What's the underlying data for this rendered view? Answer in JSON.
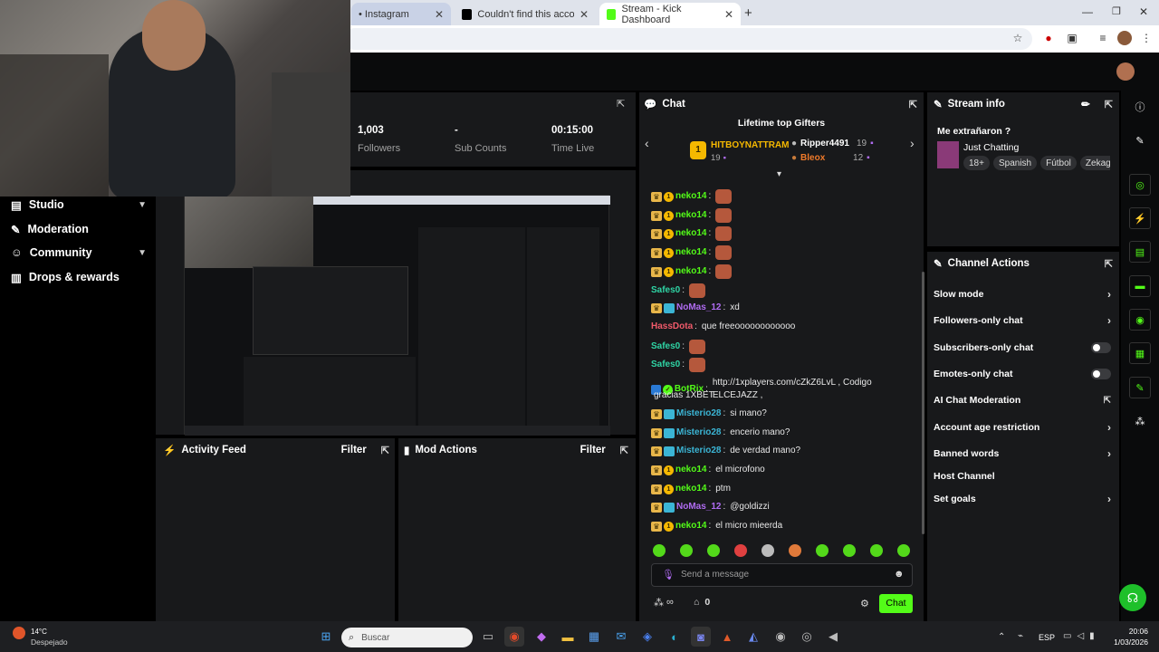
{
  "browser": {
    "tabs": [
      {
        "label": "• Instagram"
      },
      {
        "label": "Couldn't find this account. Visit"
      },
      {
        "label": "Stream - Kick Dashboard"
      }
    ]
  },
  "sidebar": {
    "items": [
      {
        "label": "Studio",
        "icon": "studio-icon",
        "has_chevron": true
      },
      {
        "label": "Moderation",
        "icon": "wrench-icon",
        "has_chevron": false
      },
      {
        "label": "Community",
        "icon": "people-icon",
        "has_chevron": true
      },
      {
        "label": "Drops & rewards",
        "icon": "gift-icon",
        "has_chevron": false
      }
    ]
  },
  "stats": [
    {
      "value": "1,003",
      "label": "Followers"
    },
    {
      "value": "-",
      "label": "Sub Counts"
    },
    {
      "value": "00:15:00",
      "label": "Time Live"
    }
  ],
  "activity_feed": {
    "title": "Activity Feed",
    "filter": "Filter"
  },
  "mod_actions": {
    "title": "Mod Actions",
    "filter": "Filter"
  },
  "chat": {
    "title": "Chat",
    "gifters": {
      "title": "Lifetime top Gifters",
      "first": {
        "rank": "1",
        "name": "HITBOYNATTRAM",
        "count": "19"
      },
      "second": {
        "name": "Ripper4491",
        "count": "19"
      },
      "third": {
        "name": "Bleox",
        "count": "12"
      }
    },
    "messages": [
      {
        "user": "neko14",
        "text": "",
        "color": "#53fc18",
        "badge": "crown-coin",
        "emote": true
      },
      {
        "user": "neko14",
        "text": "",
        "color": "#53fc18",
        "badge": "crown-coin",
        "emote": true
      },
      {
        "user": "neko14",
        "text": "",
        "color": "#53fc18",
        "badge": "crown-coin",
        "emote": true
      },
      {
        "user": "neko14",
        "text": "",
        "color": "#53fc18",
        "badge": "crown-coin",
        "emote": true
      },
      {
        "user": "neko14",
        "text": "",
        "color": "#53fc18",
        "badge": "crown-coin",
        "emote": true
      },
      {
        "user": "Safes0",
        "text": "",
        "color": "#2fd5a5",
        "badge": "none",
        "emote": true
      },
      {
        "user": "NoMas_12",
        "text": "xd",
        "color": "#b06cf2",
        "badge": "crown-box",
        "emote": false
      },
      {
        "user": "HassDota",
        "text": "que freeoooooooooooo",
        "color": "#f05a6a",
        "badge": "none",
        "emote": false
      },
      {
        "user": "Safes0",
        "text": "",
        "color": "#2fd5a5",
        "badge": "none",
        "emote": true
      },
      {
        "user": "Safes0",
        "text": "",
        "color": "#2fd5a5",
        "badge": "none",
        "emote": true
      },
      {
        "user": "BotRix",
        "text": "http://1xplayers.com/cZkZ6LvL , Codigo ELCEJAZZ ,",
        "color": "#53fc18",
        "badge": "bot",
        "emote": false
      },
      {
        "user": "",
        "text": "gracias 1XBET",
        "color": "#e8e8e8",
        "badge": "none",
        "emote": false
      },
      {
        "user": "Misterio28",
        "text": "si mano?",
        "color": "#3bb5d5",
        "badge": "crown-box",
        "emote": false
      },
      {
        "user": "Misterio28",
        "text": "encerio mano?",
        "color": "#3bb5d5",
        "badge": "crown-box",
        "emote": false
      },
      {
        "user": "Misterio28",
        "text": "de verdad mano?",
        "color": "#3bb5d5",
        "badge": "crown-box",
        "emote": false
      },
      {
        "user": "neko14",
        "text": "el microfono",
        "color": "#53fc18",
        "badge": "crown-coin",
        "emote": false
      },
      {
        "user": "neko14",
        "text": "ptm",
        "color": "#53fc18",
        "badge": "crown-coin",
        "emote": false
      },
      {
        "user": "NoMas_12",
        "text": "@goldizzi",
        "color": "#b06cf2",
        "badge": "crown-box",
        "emote": false
      },
      {
        "user": "neko14",
        "text": "el micro mieerda",
        "color": "#53fc18",
        "badge": "crown-coin",
        "emote": false
      }
    ],
    "input_placeholder": "Send a message",
    "points": "∞",
    "store_count": "0",
    "send_label": "Chat"
  },
  "stream_info": {
    "title": "Stream info",
    "stream_title": "Me extrañaron ?",
    "category": "Just Chatting",
    "tags": [
      "18+",
      "Spanish",
      "Fútbol",
      "Zekag"
    ]
  },
  "channel_actions": {
    "title": "Channel Actions",
    "items": [
      {
        "label": "Slow mode",
        "control": "chevron"
      },
      {
        "label": "Followers-only chat",
        "control": "chevron"
      },
      {
        "label": "Subscribers-only chat",
        "control": "toggle"
      },
      {
        "label": "Emotes-only chat",
        "control": "toggle"
      },
      {
        "label": "AI Chat Moderation",
        "control": "external"
      },
      {
        "label": "Account age restriction",
        "control": "chevron"
      },
      {
        "label": "Banned words",
        "control": "chevron"
      },
      {
        "label": "Host Channel",
        "control": "none"
      },
      {
        "label": "Set goals",
        "control": "chevron"
      }
    ]
  },
  "taskbar": {
    "weather_temp": "14°C",
    "weather_desc": "Despejado",
    "search_placeholder": "Buscar",
    "lang": "ESP",
    "time": "20:06",
    "date": "1/03/2026"
  },
  "colors": {
    "accent": "#53fc18",
    "panel": "#18191b",
    "gold": "#f5b800"
  }
}
